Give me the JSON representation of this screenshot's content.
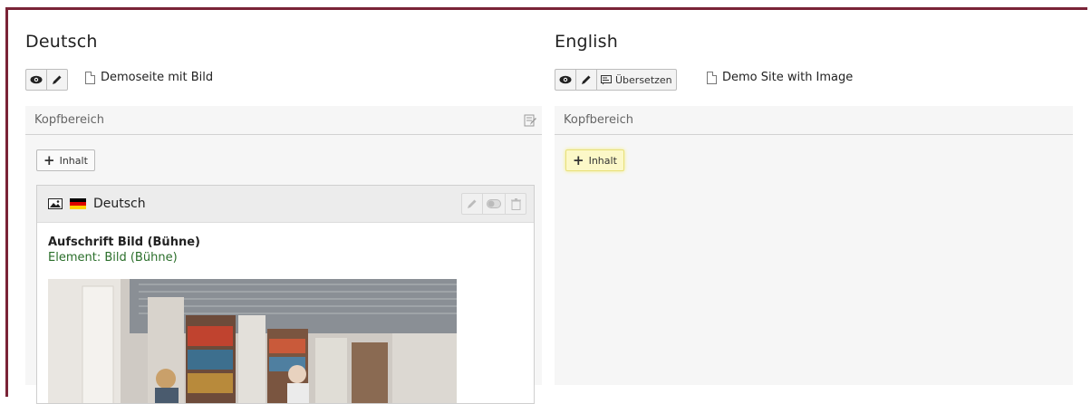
{
  "left": {
    "language_title": "Deutsch",
    "page_title": "Demoseite mit Bild",
    "section_label": "Kopfbereich",
    "add_content_label": "Inhalt",
    "element": {
      "language_label": "Deutsch",
      "header": "Aufschrift Bild (Bühne)",
      "type_line": "Element: Bild (Bühne)"
    }
  },
  "right": {
    "language_title": "English",
    "translate_label": "Übersetzen",
    "page_title": "Demo Site with Image",
    "section_label": "Kopfbereich",
    "add_content_label": "Inhalt"
  },
  "colors": {
    "frame": "#7a2437",
    "highlight_button": "#fcf8c8",
    "element_type_text": "#2a6e2a"
  },
  "icons": [
    "eye-icon",
    "pencil-icon",
    "document-icon",
    "translate-icon",
    "image-icon",
    "flag-de-icon",
    "toggle-icon",
    "trash-icon",
    "edit-section-icon",
    "plus-icon"
  ]
}
